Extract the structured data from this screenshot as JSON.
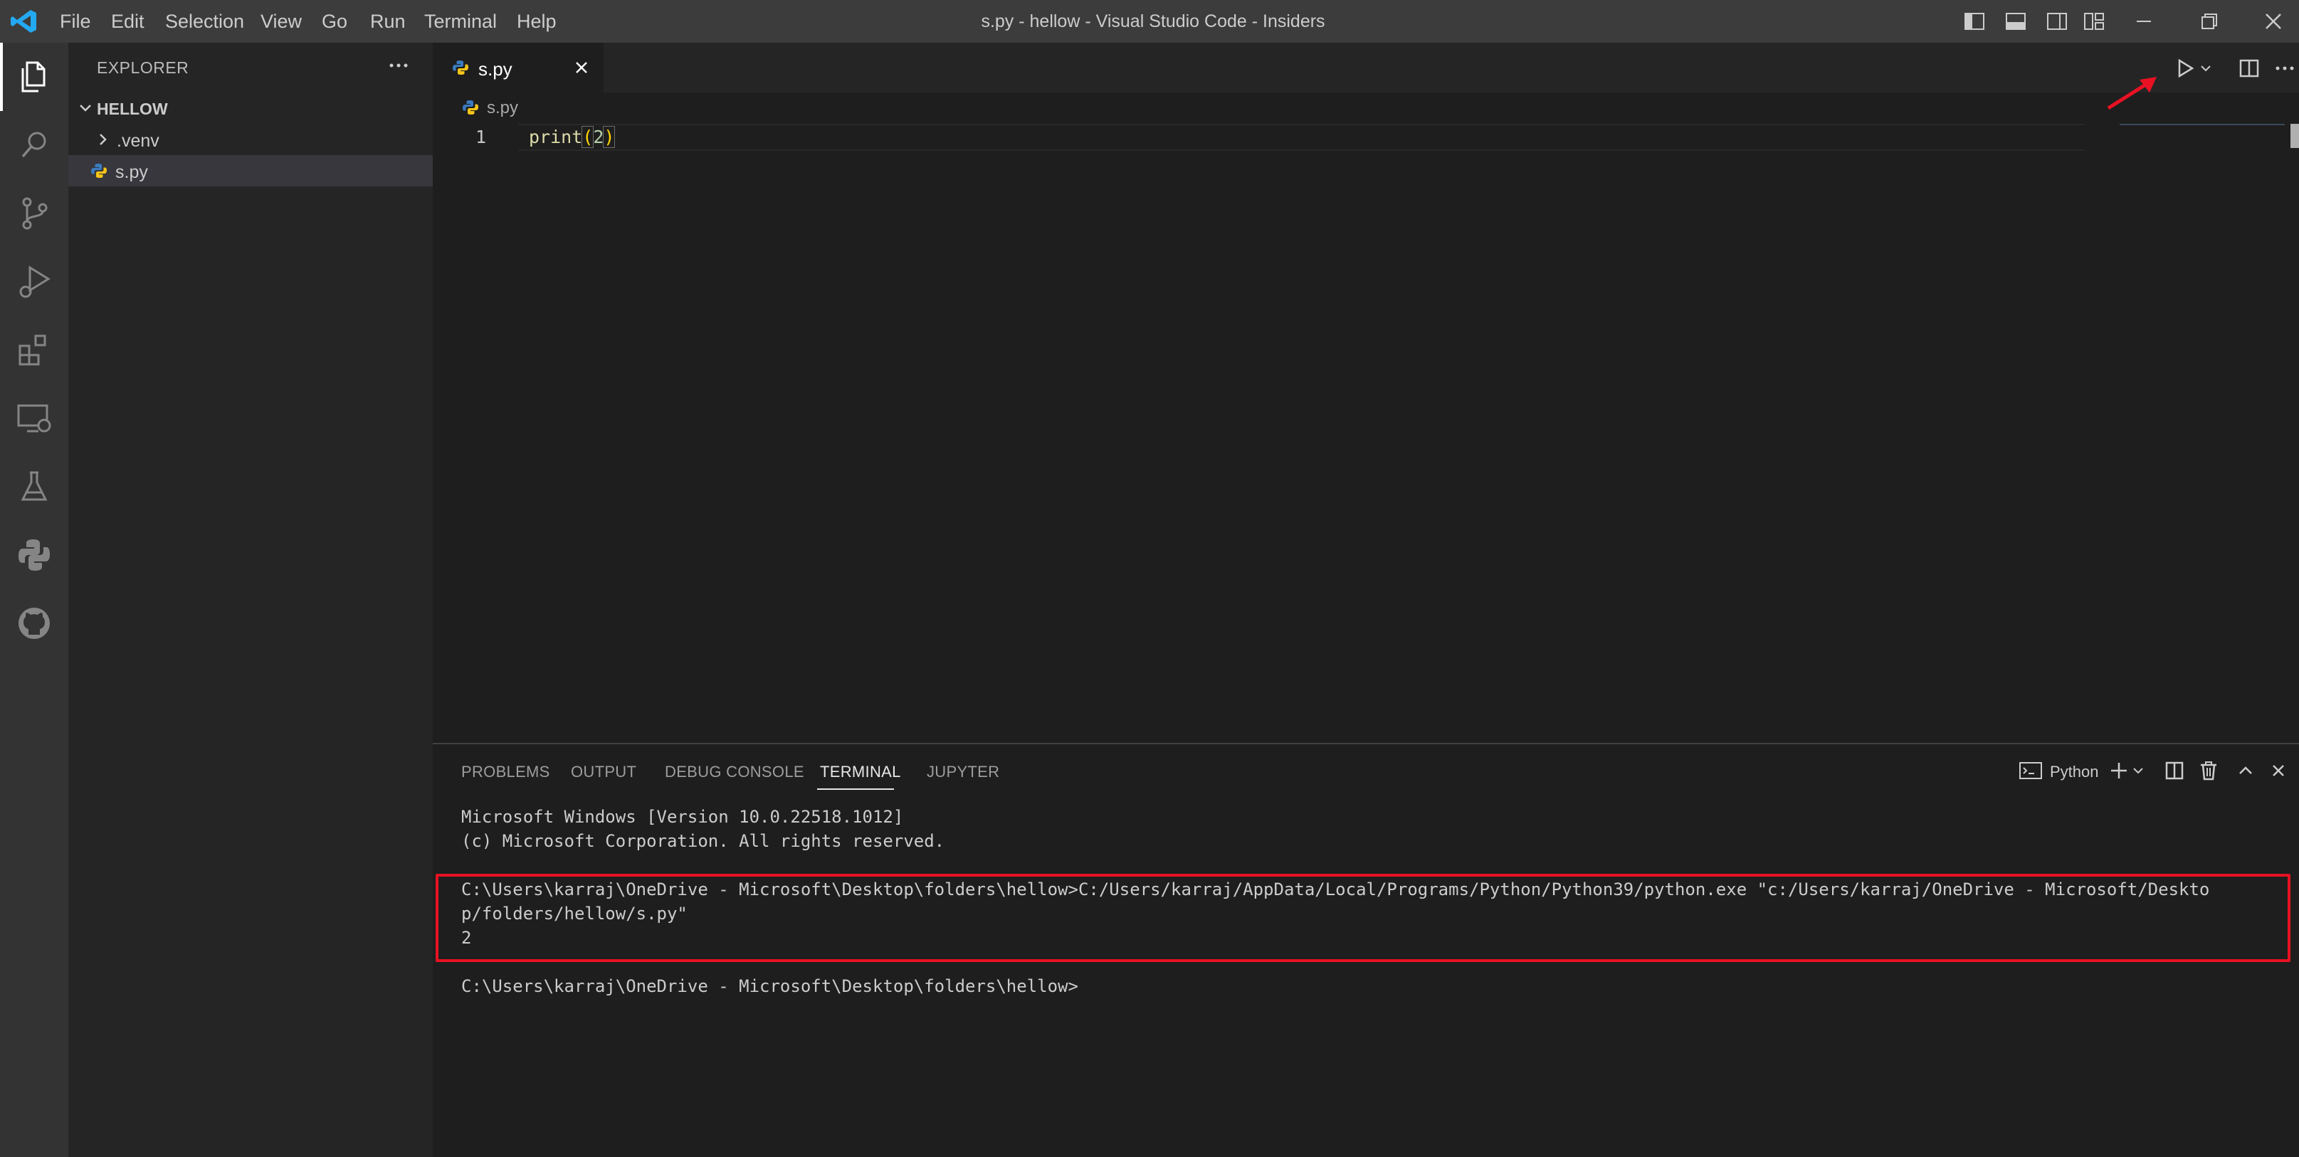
{
  "titlebar": {
    "menu": [
      "File",
      "Edit",
      "Selection",
      "View",
      "Go",
      "Run",
      "Terminal",
      "Help"
    ],
    "window_title": "s.py - hellow - Visual Studio Code - Insiders",
    "logo_color": "#23a9f2"
  },
  "activity_bar": {
    "icons": [
      "explorer-icon",
      "search-icon",
      "source-control-icon",
      "run-debug-icon",
      "extensions-icon",
      "remote-explorer-icon",
      "testing-icon",
      "python-icon",
      "github-icon"
    ]
  },
  "sidebar": {
    "title": "EXPLORER",
    "folder": "HELLOW",
    "items": [
      {
        "label": ".venv",
        "type": "folder"
      },
      {
        "label": "s.py",
        "type": "file",
        "selected": true
      }
    ]
  },
  "editor": {
    "tab": {
      "label": "s.py"
    },
    "breadcrumb": "s.py",
    "lines": [
      {
        "number": "1",
        "fn": "print",
        "open": "(",
        "arg": "2",
        "close": ")"
      }
    ]
  },
  "panel": {
    "tabs": [
      "PROBLEMS",
      "OUTPUT",
      "DEBUG CONSOLE",
      "TERMINAL",
      "JUPYTER"
    ],
    "active_tab": "TERMINAL",
    "terminal_kind": "Python",
    "terminal_lines": [
      "Microsoft Windows [Version 10.0.22518.1012]",
      "(c) Microsoft Corporation. All rights reserved.",
      "C:\\Users\\karraj\\OneDrive - Microsoft\\Desktop\\folders\\hellow>C:/Users/karraj/AppData/Local/Programs/Python/Python39/python.exe \"c:/Users/karraj/OneDrive - Microsoft/Deskto",
      "p/folders/hellow/s.py\"",
      "2",
      "C:\\Users\\karraj\\OneDrive - Microsoft\\Desktop\\folders\\hellow>"
    ]
  },
  "colors": {
    "accent_red": "#e81123",
    "function": "#dcdcaa",
    "bracket": "#ffd700",
    "number": "#b5cea8"
  }
}
